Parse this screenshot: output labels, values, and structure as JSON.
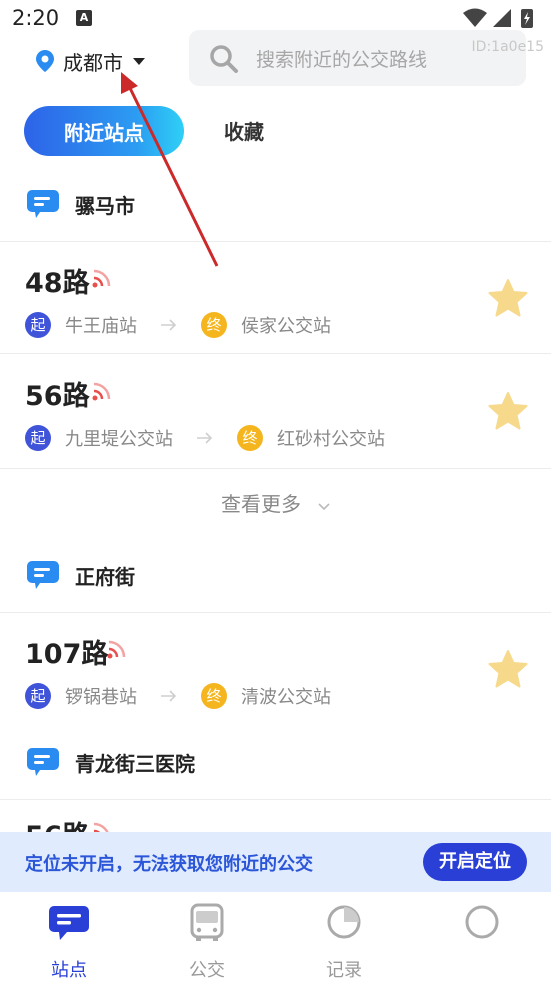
{
  "status_bar": {
    "time": "2:20",
    "notification_letter": "A"
  },
  "header": {
    "city": "成都市",
    "search_placeholder": "搜索附近的公交路线",
    "id_watermark": "ID:1a0e15"
  },
  "tabs": [
    {
      "label": "附近站点",
      "active": true
    },
    {
      "label": "收藏",
      "active": false
    }
  ],
  "stations": [
    {
      "name": "骡马市",
      "routes": [
        {
          "name": "48路",
          "start": "牛王庙站",
          "end": "侯家公交站",
          "favorited": false
        },
        {
          "name": "56路",
          "start": "九里堤公交站",
          "end": "红砂村公交站",
          "favorited": false
        }
      ],
      "more_label": "查看更多"
    },
    {
      "name": "正府街",
      "routes": [
        {
          "name": "107路",
          "start": "锣锅巷站",
          "end": "清波公交站",
          "favorited": false
        }
      ]
    },
    {
      "name": "青龙街三医院",
      "routes": [
        {
          "name": "56路"
        }
      ]
    }
  ],
  "badges": {
    "start": "起",
    "end": "终"
  },
  "banner": {
    "text": "定位未开启，无法获取您附近的公交",
    "button": "开启定位"
  },
  "bottom_nav": [
    {
      "label": "站点",
      "icon": "station-icon",
      "active": true
    },
    {
      "label": "公交",
      "icon": "bus-icon",
      "active": false
    },
    {
      "label": "记录",
      "icon": "record-icon",
      "active": false
    },
    {
      "label": "",
      "icon": "profile-icon",
      "active": false
    }
  ],
  "colors": {
    "primary": "#2a3fd6",
    "accent_gradient_start": "#2d63e8",
    "accent_gradient_end": "#2ed0f6",
    "start_badge": "#3f54d9",
    "end_badge": "#f4b51e",
    "star": "#f7d98c",
    "signal": "#e8504e",
    "annotation_arrow": "#cc2a2a"
  }
}
